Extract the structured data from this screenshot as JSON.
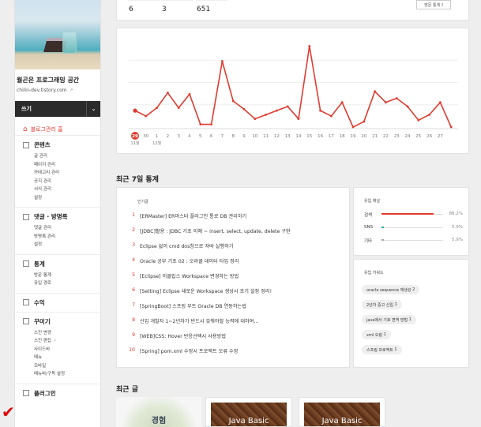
{
  "sidebar": {
    "blog_name": "월곤은 프로그래밍 공간",
    "blog_url": "chilin-dev.tistory.com",
    "write_label": "쓰기",
    "home_label": "블로그관리 홈",
    "sections": [
      {
        "title": "콘텐츠",
        "icon": "document-icon",
        "items": [
          "글 관리",
          "페이지 관리",
          "카테고리 관리",
          "공지 관리",
          "서식 관리",
          "설정"
        ]
      },
      {
        "title": "댓글 · 방명록",
        "icon": "comment-icon",
        "items": [
          "댓글 관리",
          "방명록 관리",
          "설정"
        ]
      },
      {
        "title": "통계",
        "icon": "chart-icon",
        "items": [
          "방문 통계",
          "유입 경로"
        ]
      },
      {
        "title": "수익",
        "icon": "money-icon",
        "items": []
      },
      {
        "title": "꾸미기",
        "icon": "brush-icon",
        "items": [
          "스킨 변경",
          "스킨 편집",
          "사이드바",
          "메뉴",
          "모바일",
          "메뉴바/구독 설정"
        ]
      },
      {
        "title": "플러그인",
        "icon": "plugin-icon",
        "items": []
      }
    ]
  },
  "top_stats": {
    "values": [
      "6",
      "3",
      "651"
    ],
    "button_label": "방문 통계"
  },
  "chart_data": {
    "type": "line",
    "x": [
      "29",
      "30",
      "1",
      "2",
      "3",
      "4",
      "5",
      "6",
      "7",
      "8",
      "9",
      "10",
      "11",
      "12",
      "13",
      "14",
      "15",
      "16",
      "17",
      "18",
      "19",
      "20",
      "21",
      "22",
      "23",
      "24",
      "25",
      "26",
      "27",
      ""
    ],
    "month_labels": [
      {
        "index": 0,
        "label": "11월"
      },
      {
        "index": 2,
        "label": "12월"
      }
    ],
    "highlight_index": 0,
    "series": [
      {
        "values": [
          12,
          8,
          14,
          25,
          14,
          24,
          2,
          2,
          48,
          19,
          13,
          6,
          9,
          12,
          15,
          6,
          59,
          12,
          8,
          18,
          0,
          4,
          26,
          18,
          21,
          15,
          5,
          9,
          18,
          0
        ]
      }
    ],
    "ylim": [
      0,
      65
    ],
    "grid": true,
    "color": "#e03c31"
  },
  "weekly": {
    "title": "최근 7일 통계",
    "popular_label": "인기글",
    "popular": [
      "[ERMaster] ER마스터 플러그인 통로 DB 관리하기",
      "[JDBC]활용 : JDBC 기초 이해 ~ insert, select, update, delete 구현",
      "Eclipse 없이 cmd dos창으로 자바 실행하기",
      "Oracle 공부 기초 02 : 오라클 데이터 타입 정리",
      "[Eclipse] 이클립스 Workspace 변경하는 방법",
      "[Setting] Eclipse 새로운 Workspace 생성시 초기 설정 정리!",
      "[SpringBoot] 스프링 부트 Oracle DB 연동하는법",
      "신입 개발자 1~2년차가 반드시 갖춰야할 능력에 대하여...",
      "[WEB]CSS: Hover 반응선택시 사용방법",
      "[Spring] pom.xml 수정시 프로젝트 오류 수정"
    ],
    "referrer_label": "유입 채널",
    "referrers": [
      {
        "name": "검색",
        "pct": "88.2%",
        "value": 88.2
      },
      {
        "name": "SNS",
        "pct": "5.9%",
        "value": 5.9
      },
      {
        "name": "기타",
        "pct": "5.9%",
        "value": 5.9
      }
    ],
    "keyword_label": "유입 키워드",
    "keywords": [
      {
        "text": "oracle sequence 재생성",
        "count": "2"
      },
      {
        "text": "2년차 중고 신입",
        "count": "1"
      },
      {
        "text": "java에서 기호 변역 방법",
        "count": "1"
      },
      {
        "text": "xml 오링",
        "count": "1"
      },
      {
        "text": "스프링 프로젝트",
        "count": "1"
      }
    ]
  },
  "recent": {
    "title": "최근 글",
    "posts": [
      {
        "thumb_text": "경험"
      },
      {
        "thumb_text": "Java Basic"
      },
      {
        "thumb_text": "Java Basic"
      }
    ]
  }
}
